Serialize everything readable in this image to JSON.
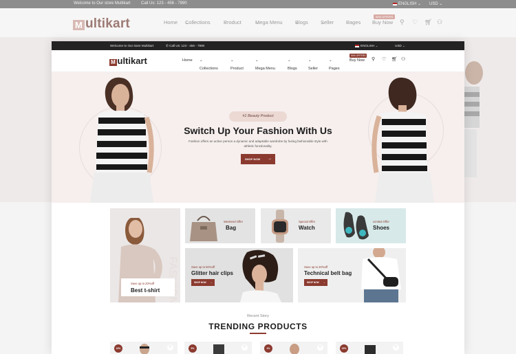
{
  "topbar": {
    "welcome": "Welcome to Our store Multikart",
    "call": "Call Us: 123 - 456 - 7890",
    "language": "ENGLISH",
    "currency": "USD"
  },
  "brand": {
    "logo_initial": "M",
    "logo_rest": "ultikart"
  },
  "nav": {
    "items": [
      "Home",
      "Collections",
      "Product",
      "Mega Menu",
      "Blogs",
      "Seller",
      "Pages",
      "Buy Now"
    ],
    "sale_badge": "50% OFFERS"
  },
  "hero": {
    "badge": "#1 Beauty Product",
    "title": "Switch Up Your Fashion With Us",
    "description": "Fashion offers an active person a dynamic and adaptable wardrobe by fusing fashionable style with athletic functionality.",
    "button": "SHOP NOW"
  },
  "banners": {
    "bag": {
      "eyebrow": "Weekend Offer",
      "title": "Bag"
    },
    "watch": {
      "eyebrow": "Special Offer",
      "title": "Watch"
    },
    "shoes": {
      "eyebrow": "Limited Offer",
      "title": "Shoes"
    },
    "tshirt": {
      "eyebrow": "Save up to 20%off",
      "title": "Best t-shirt"
    },
    "clips": {
      "eyebrow": "Save up to 50%off",
      "title": "Glitter hair clips",
      "button": "SHOP NOW"
    },
    "beltbag": {
      "eyebrow": "Save up to 20%off",
      "title": "Technical belt bag",
      "button": "SHOP NOW"
    }
  },
  "trending": {
    "subtitle": "Recent Story",
    "title": "TRENDING PRODUCTS",
    "discounts": [
      "15%",
      "5%",
      "2%",
      "15%"
    ]
  },
  "colors": {
    "accent": "#8b3a2f",
    "hero_bg": "#f6efee",
    "topbar_bg": "#232323"
  }
}
